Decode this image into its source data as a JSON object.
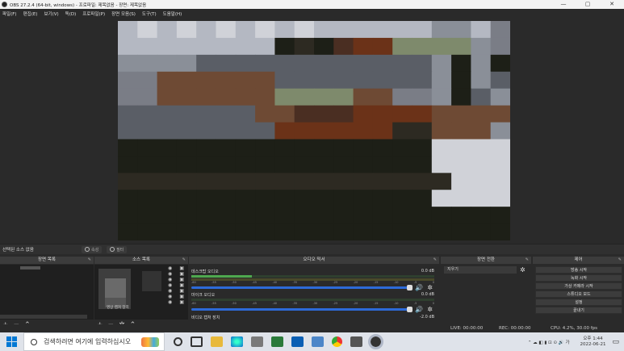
{
  "window": {
    "title": "OBS 27.2.4 (64-bit, windows) - 프로파일: 제목없음 - 장면: 제목없음",
    "minimize": "—",
    "maximize": "▢",
    "close": "✕"
  },
  "menu": [
    "파일(F)",
    "편집(E)",
    "보기(V)",
    "독(D)",
    "프로파일(P)",
    "장면 모음(S)",
    "도구(T)",
    "도움말(H)"
  ],
  "source_toolbar": {
    "no_source": "선택된 소스 없음",
    "properties": "속성",
    "filters": "필터"
  },
  "docks": {
    "scenes": {
      "title": "장면 목록"
    },
    "sources": {
      "title": "소스 목록",
      "item_label": "영상 캡처 장치"
    },
    "mixer": {
      "title": "오디오 믹서",
      "channels": [
        {
          "name": "데스크탑 오디오",
          "db": "0.0 dB"
        },
        {
          "name": "마이크 오디오",
          "db": "0.0 dB"
        },
        {
          "name": "비디오 캡처 장치",
          "db": "-2.0 dB"
        }
      ],
      "ticks": [
        "-60",
        "-55",
        "-50",
        "-45",
        "-40",
        "-35",
        "-30",
        "-25",
        "-20",
        "-15",
        "-10",
        "-5",
        "0"
      ]
    },
    "transitions": {
      "title": "장면 전환",
      "selected": "지우기"
    },
    "controls": {
      "title": "제어",
      "buttons": [
        "방송 시작",
        "녹화 시작",
        "가상 카메라 시작",
        "스튜디오 모드",
        "설정",
        "끝내기"
      ]
    }
  },
  "status": {
    "live": "LIVE: 00:00:00",
    "rec": "REC: 00:00:00",
    "cpu": "CPU: 4.2%, 30.00 fps"
  },
  "taskbar": {
    "search_placeholder": "검색하려면 여기에 입력하십시오",
    "time": "오후 1:44",
    "date": "2022-06-21"
  }
}
